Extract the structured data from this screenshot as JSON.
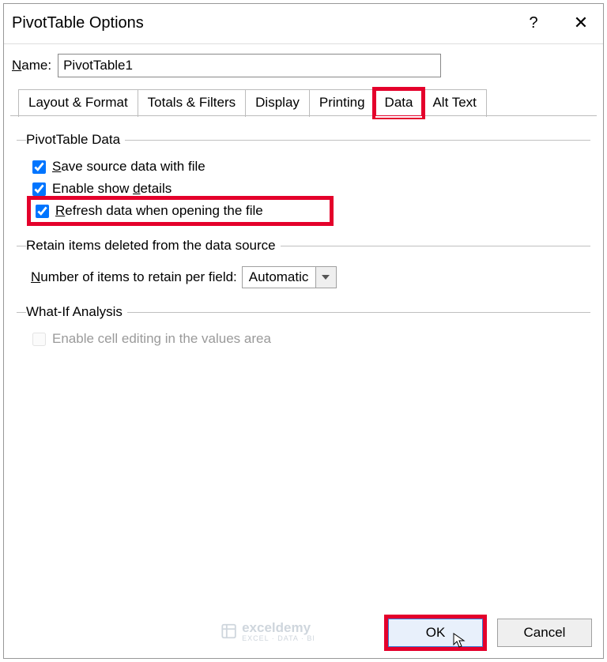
{
  "dialog": {
    "title": "PivotTable Options",
    "help_glyph": "?",
    "close_glyph": "✕"
  },
  "name": {
    "label_pre": "",
    "label_ul": "N",
    "label_post": "ame:",
    "value": "PivotTable1"
  },
  "tabs": {
    "layout": "Layout & Format",
    "totals": "Totals & Filters",
    "display": "Display",
    "printing": "Printing",
    "data": "Data",
    "alttext": "Alt Text",
    "active": "data"
  },
  "group1": {
    "legend": "PivotTable Data",
    "save": {
      "checked": true,
      "pre": "",
      "ul": "S",
      "post": "ave source data with file"
    },
    "enable": {
      "checked": true,
      "pre": "Enable show ",
      "ul": "d",
      "post": "etails"
    },
    "refresh": {
      "checked": true,
      "pre": "",
      "ul": "R",
      "post": "efresh data when opening the file"
    }
  },
  "group2": {
    "legend": "Retain items deleted from the data source",
    "label_pre": "",
    "label_ul": "N",
    "label_post": "umber of items to retain per field:",
    "selected": "Automatic"
  },
  "group3": {
    "legend": "What-If Analysis",
    "enable_edit": {
      "checked": false,
      "label": "Enable cell editing in the values area",
      "disabled": true
    }
  },
  "buttons": {
    "ok": "OK",
    "cancel": "Cancel"
  },
  "watermark": {
    "brand": "exceldemy",
    "sub": "EXCEL · DATA · BI"
  }
}
